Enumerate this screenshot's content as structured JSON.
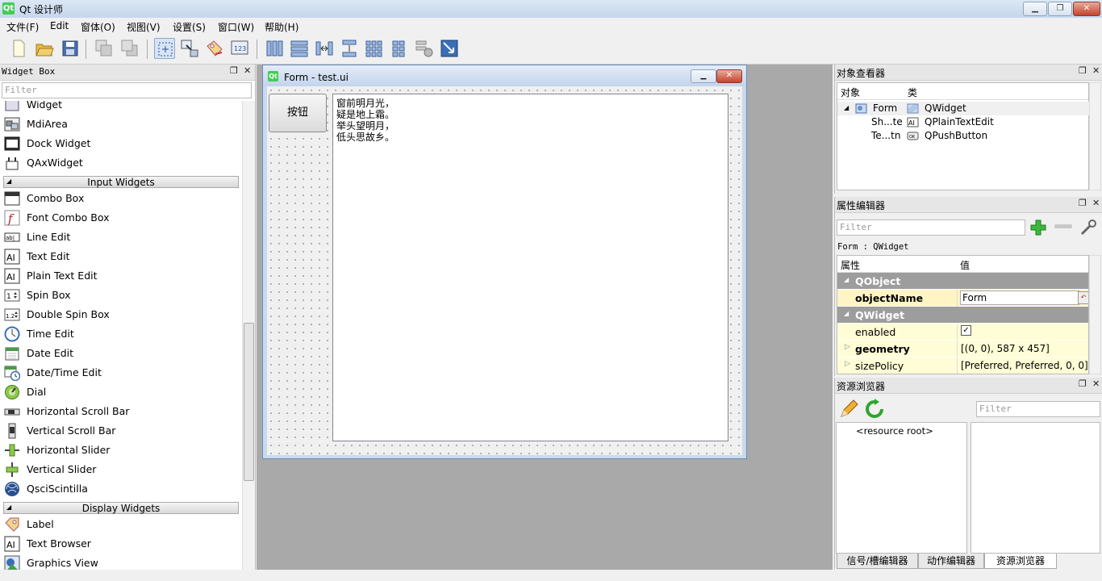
{
  "window": {
    "title": "Qt 设计师",
    "min": "▁",
    "max": "❐",
    "close": "✕",
    "app_icon": "Qt"
  },
  "menu": [
    "文件(F)",
    "Edit",
    "窗体(O)",
    "视图(V)",
    "设置(S)",
    "窗口(W)",
    "帮助(H)"
  ],
  "widget_box": {
    "title": "Widget Box",
    "filter_placeholder": "Filter",
    "items": [
      {
        "type": "item",
        "label": "Widget",
        "icon": "widget-icon"
      },
      {
        "type": "item",
        "label": "MdiArea",
        "icon": "mdi-area-icon"
      },
      {
        "type": "item",
        "label": "Dock Widget",
        "icon": "dock-widget-icon"
      },
      {
        "type": "item",
        "label": "QAxWidget",
        "icon": "qaxwidget-icon"
      },
      {
        "type": "cat",
        "label": "Input Widgets"
      },
      {
        "type": "item",
        "label": "Combo Box",
        "icon": "combo-box-icon"
      },
      {
        "type": "item",
        "label": "Font Combo Box",
        "icon": "font-combo-icon"
      },
      {
        "type": "item",
        "label": "Line Edit",
        "icon": "line-edit-icon"
      },
      {
        "type": "item",
        "label": "Text Edit",
        "icon": "text-edit-icon"
      },
      {
        "type": "item",
        "label": "Plain Text Edit",
        "icon": "plain-text-edit-icon"
      },
      {
        "type": "item",
        "label": "Spin Box",
        "icon": "spin-box-icon"
      },
      {
        "type": "item",
        "label": "Double Spin Box",
        "icon": "double-spin-box-icon"
      },
      {
        "type": "item",
        "label": "Time Edit",
        "icon": "clock-icon"
      },
      {
        "type": "item",
        "label": "Date Edit",
        "icon": "calendar-icon"
      },
      {
        "type": "item",
        "label": "Date/Time Edit",
        "icon": "calendar-clock-icon"
      },
      {
        "type": "item",
        "label": "Dial",
        "icon": "dial-icon"
      },
      {
        "type": "item",
        "label": "Horizontal Scroll Bar",
        "icon": "hscroll-icon"
      },
      {
        "type": "item",
        "label": "Vertical Scroll Bar",
        "icon": "vscroll-icon"
      },
      {
        "type": "item",
        "label": "Horizontal Slider",
        "icon": "hslider-icon"
      },
      {
        "type": "item",
        "label": "Vertical Slider",
        "icon": "vslider-icon"
      },
      {
        "type": "item",
        "label": "QsciScintilla",
        "icon": "scintilla-icon"
      },
      {
        "type": "cat",
        "label": "Display Widgets"
      },
      {
        "type": "item",
        "label": "Label",
        "icon": "label-tag-icon"
      },
      {
        "type": "item",
        "label": "Text Browser",
        "icon": "text-browser-icon"
      },
      {
        "type": "item",
        "label": "Graphics View",
        "icon": "graphics-view-icon"
      }
    ]
  },
  "form": {
    "title": "Form - test.ui",
    "button_label": "按钮",
    "text": "窗前明月光，\n疑是地上霜。\n举头望明月，\n低头思故乡。"
  },
  "object_inspector": {
    "title": "对象查看器",
    "col_object": "对象",
    "col_class": "类",
    "rows": [
      {
        "name": "Form",
        "class": "QWidget"
      },
      {
        "name": "Sh...te",
        "class": "QPlainTextEdit"
      },
      {
        "name": "Te...tn",
        "class": "QPushButton"
      }
    ]
  },
  "property_editor": {
    "title": "属性编辑器",
    "filter_placeholder": "Filter",
    "class_line": "Form : QWidget",
    "col_prop": "属性",
    "col_value": "值",
    "rows": [
      {
        "kind": "group",
        "key": "QObject"
      },
      {
        "kind": "prop",
        "key": "objectName",
        "value": "Form",
        "bold": true
      },
      {
        "kind": "group",
        "key": "QWidget"
      },
      {
        "kind": "prop",
        "key": "enabled",
        "value": "✓",
        "bold": false
      },
      {
        "kind": "prop",
        "key": "geometry",
        "value": "[(0, 0), 587 x 457]",
        "bold": true
      },
      {
        "kind": "prop",
        "key": "sizePolicy",
        "value": "[Preferred, Preferred, 0, 0]",
        "bold": false
      }
    ]
  },
  "resource_browser": {
    "title": "资源浏览器",
    "filter_placeholder": "Filter",
    "root": "<resource root>"
  },
  "tabs": [
    "信号/槽编辑器",
    "动作编辑器",
    "资源浏览器"
  ],
  "colors": {
    "qt_green": "#41cd52",
    "group_gray": "#9d9d9d",
    "prop_yellow": "#fffdd6"
  }
}
